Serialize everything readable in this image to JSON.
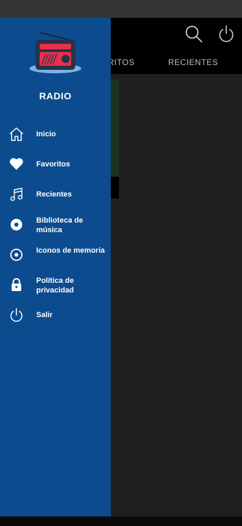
{
  "app": {
    "tabs": [
      {
        "label": "RITOS"
      },
      {
        "label": "RECIENTES"
      }
    ]
  },
  "drawer": {
    "title": "RADIO",
    "items": [
      {
        "label": "Inicio",
        "icon": "home-icon"
      },
      {
        "label": "Favoritos",
        "icon": "heart-icon"
      },
      {
        "label": "Recientes",
        "icon": "music-note-icon"
      },
      {
        "label": "Biblioteca de música",
        "icon": "disc-icon"
      },
      {
        "label": "Iconos de memoria",
        "icon": "disc-outline-icon"
      },
      {
        "label": "Política de privacidad",
        "icon": "lock-icon"
      },
      {
        "label": "Salir",
        "icon": "power-icon"
      }
    ]
  },
  "colors": {
    "drawer": "#0c4b8e",
    "accent": "#e8304a",
    "logo_body": "#24344c",
    "background": "#1f1f1f"
  }
}
